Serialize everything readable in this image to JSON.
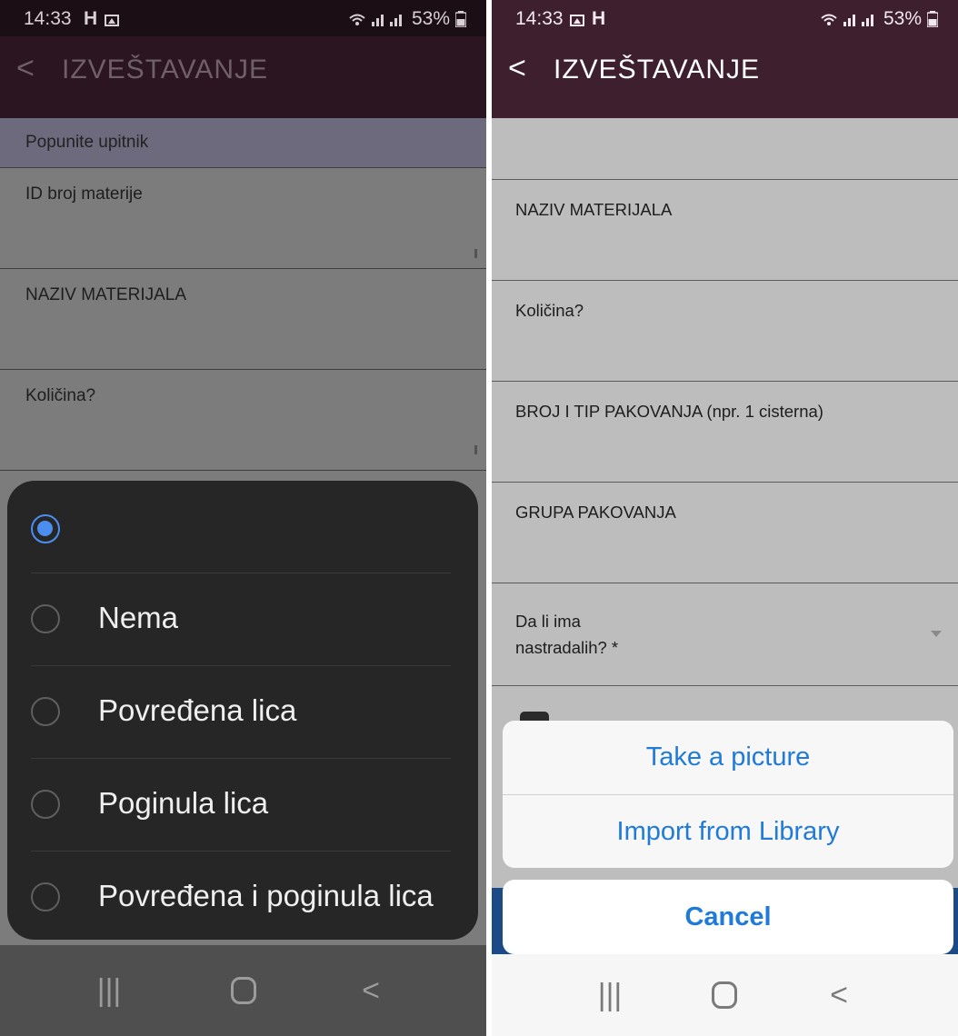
{
  "left": {
    "status": {
      "time": "14:33",
      "battery": "53%"
    },
    "app_title": "IZVEŠTAVANJE",
    "section_header": "Popunite upitnik",
    "fields": [
      "ID broj materije",
      "NAZIV MATERIJALA",
      "Količina?"
    ],
    "sheet_options": [
      {
        "label": "",
        "selected": true
      },
      {
        "label": "Nema",
        "selected": false
      },
      {
        "label": "Povređena lica",
        "selected": false
      },
      {
        "label": "Poginula lica",
        "selected": false
      },
      {
        "label": "Povređena i poginula lica",
        "selected": false
      }
    ]
  },
  "right": {
    "status": {
      "time": "14:33",
      "battery": "53%"
    },
    "app_title": "IZVEŠTAVANJE",
    "fields": [
      "NAZIV MATERIJALA",
      "Količina?",
      "BROJ I TIP PAKOVANJA (npr. 1 cisterna)",
      "GRUPA PAKOVANJA"
    ],
    "dropdown": {
      "line1": "Da li ima",
      "line2": "nastradalih? *"
    },
    "actions": {
      "take_picture": "Take a picture",
      "import_library": "Import from Library",
      "cancel": "Cancel"
    }
  },
  "colors": {
    "accent_blue": "#4c8ef0",
    "ios_blue": "#1f7ad9",
    "appbar": "#3d1f2e"
  },
  "icons": [
    "back-chevron-icon",
    "wifi-icon",
    "signal-icon",
    "battery-icon",
    "gallery-icon",
    "hbo-icon",
    "radio-icon",
    "nav-recent-icon",
    "nav-home-icon",
    "nav-back-icon"
  ]
}
